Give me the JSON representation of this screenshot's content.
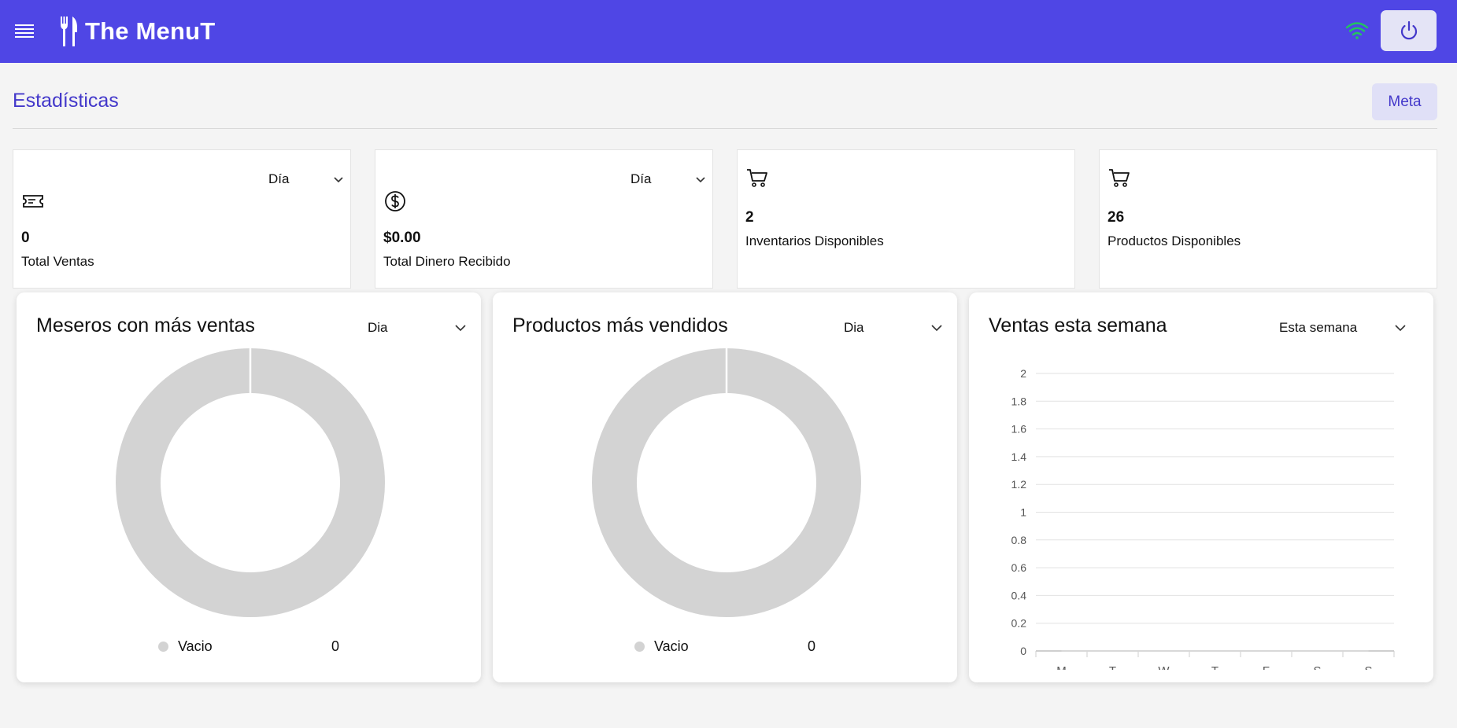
{
  "app": {
    "name": "The MenuT"
  },
  "header": {
    "menu_icon": "hamburger-icon",
    "logo_icon": "fork-knife-icon",
    "wifi_icon": "wifi-icon",
    "power_icon": "power-icon",
    "accent": "#4f46e5"
  },
  "page": {
    "title": "Estadísticas",
    "meta_button": "Meta"
  },
  "stats": [
    {
      "period": "Día",
      "icon": "ticket-icon",
      "value": "0",
      "label": "Total Ventas"
    },
    {
      "period": "Día",
      "icon": "dollar-icon",
      "value": "$0.00",
      "label": "Total Dinero Recibido"
    },
    {
      "icon": "cart-icon",
      "value": "2",
      "label": "Inventarios Disponibles"
    },
    {
      "icon": "cart-icon",
      "value": "26",
      "label": "Productos Disponibles"
    }
  ],
  "panels": {
    "meseros": {
      "title": "Meseros con más ventas",
      "period": "Dia",
      "legend": {
        "name": "Vacio",
        "value": "0"
      }
    },
    "productos": {
      "title": "Productos más vendidos",
      "period": "Dia",
      "legend": {
        "name": "Vacio",
        "value": "0"
      }
    },
    "ventas": {
      "title": "Ventas esta semana",
      "period": "Esta semana"
    }
  },
  "chart_data": [
    {
      "type": "pie",
      "title": "Meseros con más ventas",
      "categories": [
        "Vacio"
      ],
      "values": [
        0
      ],
      "empty_color": "#d3d3d3"
    },
    {
      "type": "pie",
      "title": "Productos más vendidos",
      "categories": [
        "Vacio"
      ],
      "values": [
        0
      ],
      "empty_color": "#d3d3d3"
    },
    {
      "type": "line",
      "title": "Ventas esta semana",
      "categories": [
        "M",
        "T",
        "W",
        "T",
        "F",
        "S",
        "S"
      ],
      "series": [
        {
          "values": [
            0,
            0,
            0,
            0,
            0,
            0,
            0
          ]
        }
      ],
      "ylim": [
        0,
        2
      ],
      "yticks": [
        "0",
        "0.2",
        "0.4",
        "0.6",
        "0.8",
        "1",
        "1.2",
        "1.4",
        "1.6",
        "1.8",
        "2"
      ],
      "grid": true
    }
  ]
}
